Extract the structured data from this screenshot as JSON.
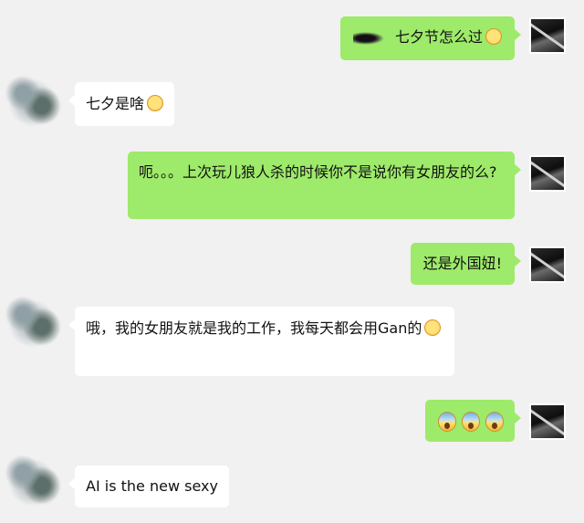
{
  "messages": [
    {
      "sender": "me",
      "text": "七夕节怎么过",
      "sticker": "scribble-sticker",
      "emoji": "smiling-blush-emoji"
    },
    {
      "sender": "other",
      "text": "七夕是啥",
      "emoji": "smiling-blush-emoji"
    },
    {
      "sender": "me",
      "text": "呃。。。上次玩儿狼人杀的时候你不是说你有女朋友的么?"
    },
    {
      "sender": "me",
      "text": "还是外国妞!"
    },
    {
      "sender": "other",
      "text": "哦，我的女朋友就是我的工作，我每天都会用Gan的",
      "emoji": "smiling-blush-emoji"
    },
    {
      "sender": "me",
      "emojis": [
        "face-screaming-emoji",
        "face-screaming-emoji",
        "face-screaming-emoji"
      ]
    },
    {
      "sender": "other",
      "text": "AI is the new sexy"
    }
  ]
}
